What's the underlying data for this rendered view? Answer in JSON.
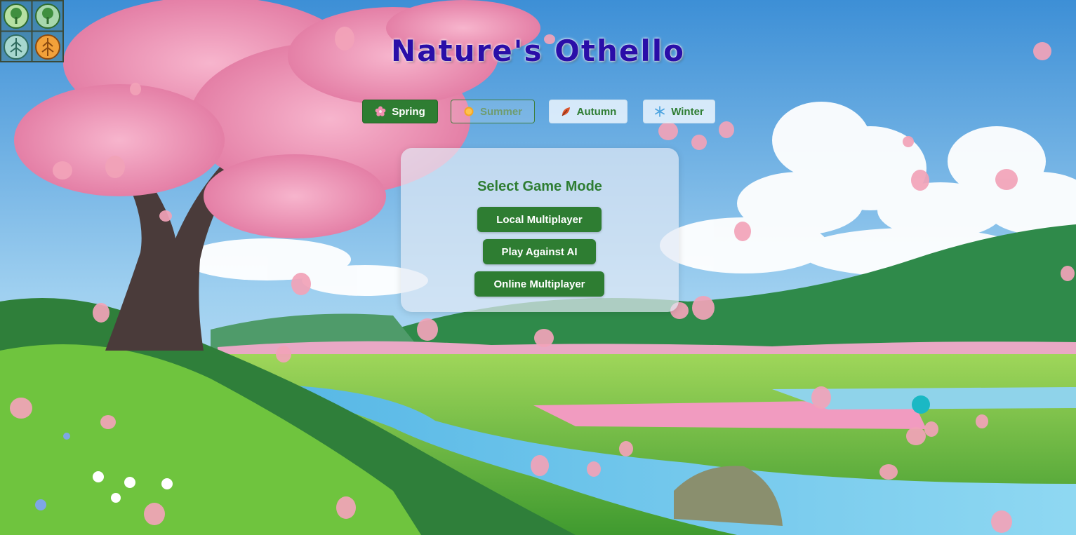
{
  "app": {
    "title": "Nature's Othello"
  },
  "seasons": [
    {
      "label": "Spring",
      "icon": "cherry-blossom-icon",
      "active": true
    },
    {
      "label": "Summer",
      "icon": "sun-icon",
      "active": false
    },
    {
      "label": "Autumn",
      "icon": "leaf-icon",
      "active": false
    },
    {
      "label": "Winter",
      "icon": "snowflake-icon",
      "active": false
    }
  ],
  "menu": {
    "heading": "Select Game Mode",
    "buttons": [
      "Local Multiplayer",
      "Play Against AI",
      "Online Multiplayer"
    ]
  },
  "logo": {
    "icon": "tree-grid-logo-icon"
  },
  "colors": {
    "accent": "#2e7d32",
    "title": "#2a0ea8",
    "petal": "#f2a3b8",
    "cursor_dot": "#1ab8c4"
  }
}
